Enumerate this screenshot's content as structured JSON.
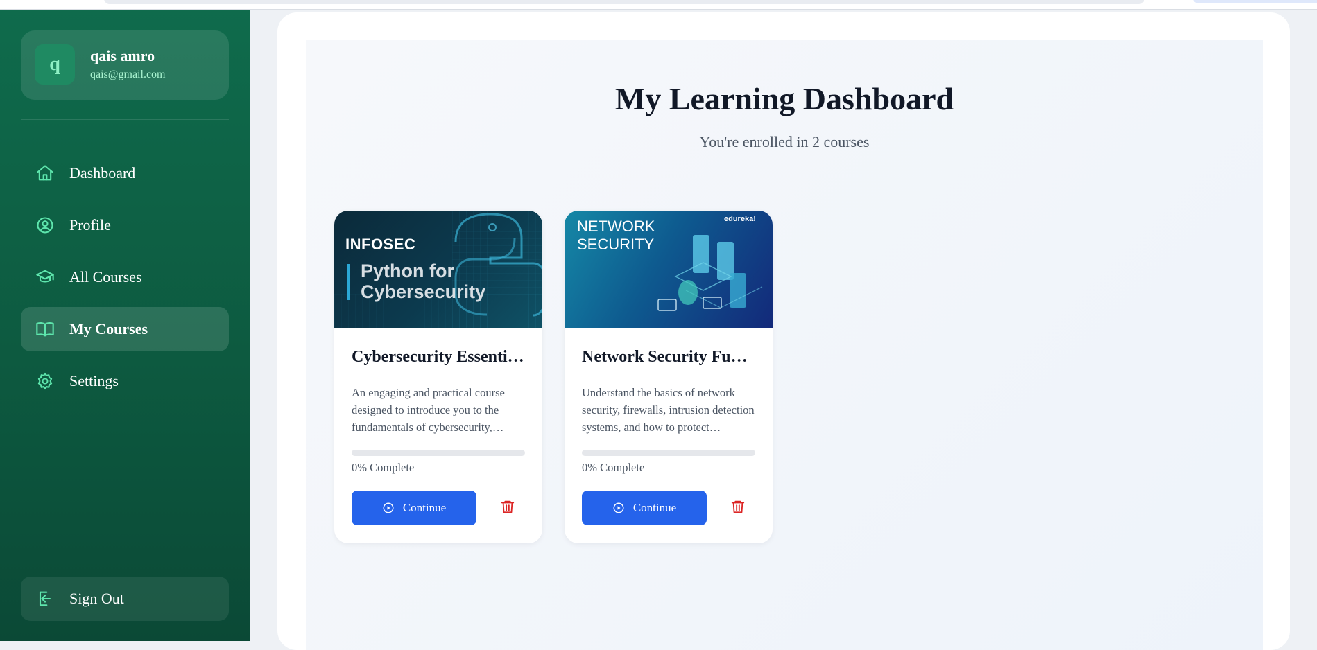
{
  "user": {
    "initial": "q",
    "name": "qais amro",
    "email": "qais@gmail.com"
  },
  "nav": {
    "items": [
      {
        "label": "Dashboard",
        "icon": "home-icon"
      },
      {
        "label": "Profile",
        "icon": "user-circle-icon"
      },
      {
        "label": "All Courses",
        "icon": "graduation-cap-icon"
      },
      {
        "label": "My Courses",
        "icon": "book-open-icon",
        "active": true
      },
      {
        "label": "Settings",
        "icon": "gear-icon"
      }
    ],
    "signout_label": "Sign Out"
  },
  "main": {
    "title": "My Learning Dashboard",
    "subtitle": "You're enrolled in 2 courses"
  },
  "courses": [
    {
      "title": "Cybersecurity Essentials",
      "description": "An engaging and practical course designed to introduce you to the fundamentals of cybersecurity, including threats and defenses.",
      "progress": 0,
      "progress_label": "0% Complete",
      "continue_label": "Continue",
      "thumb": {
        "brand": "INFOSEC",
        "line1": "Python for",
        "line2": "Cybersecurity"
      }
    },
    {
      "title": "Network Security Fundamentals",
      "description": "Understand the basics of network security, firewalls, intrusion detection systems, and how to protect networks.",
      "progress": 0,
      "progress_label": "0% Complete",
      "continue_label": "Continue",
      "thumb": {
        "line1": "NETWORK",
        "line2": "SECURITY",
        "brand": "edureka!"
      }
    }
  ],
  "colors": {
    "sidebar": "#0f6b4c",
    "accent_icon": "#5ee6ad",
    "primary": "#2563eb",
    "danger": "#dc2626"
  }
}
